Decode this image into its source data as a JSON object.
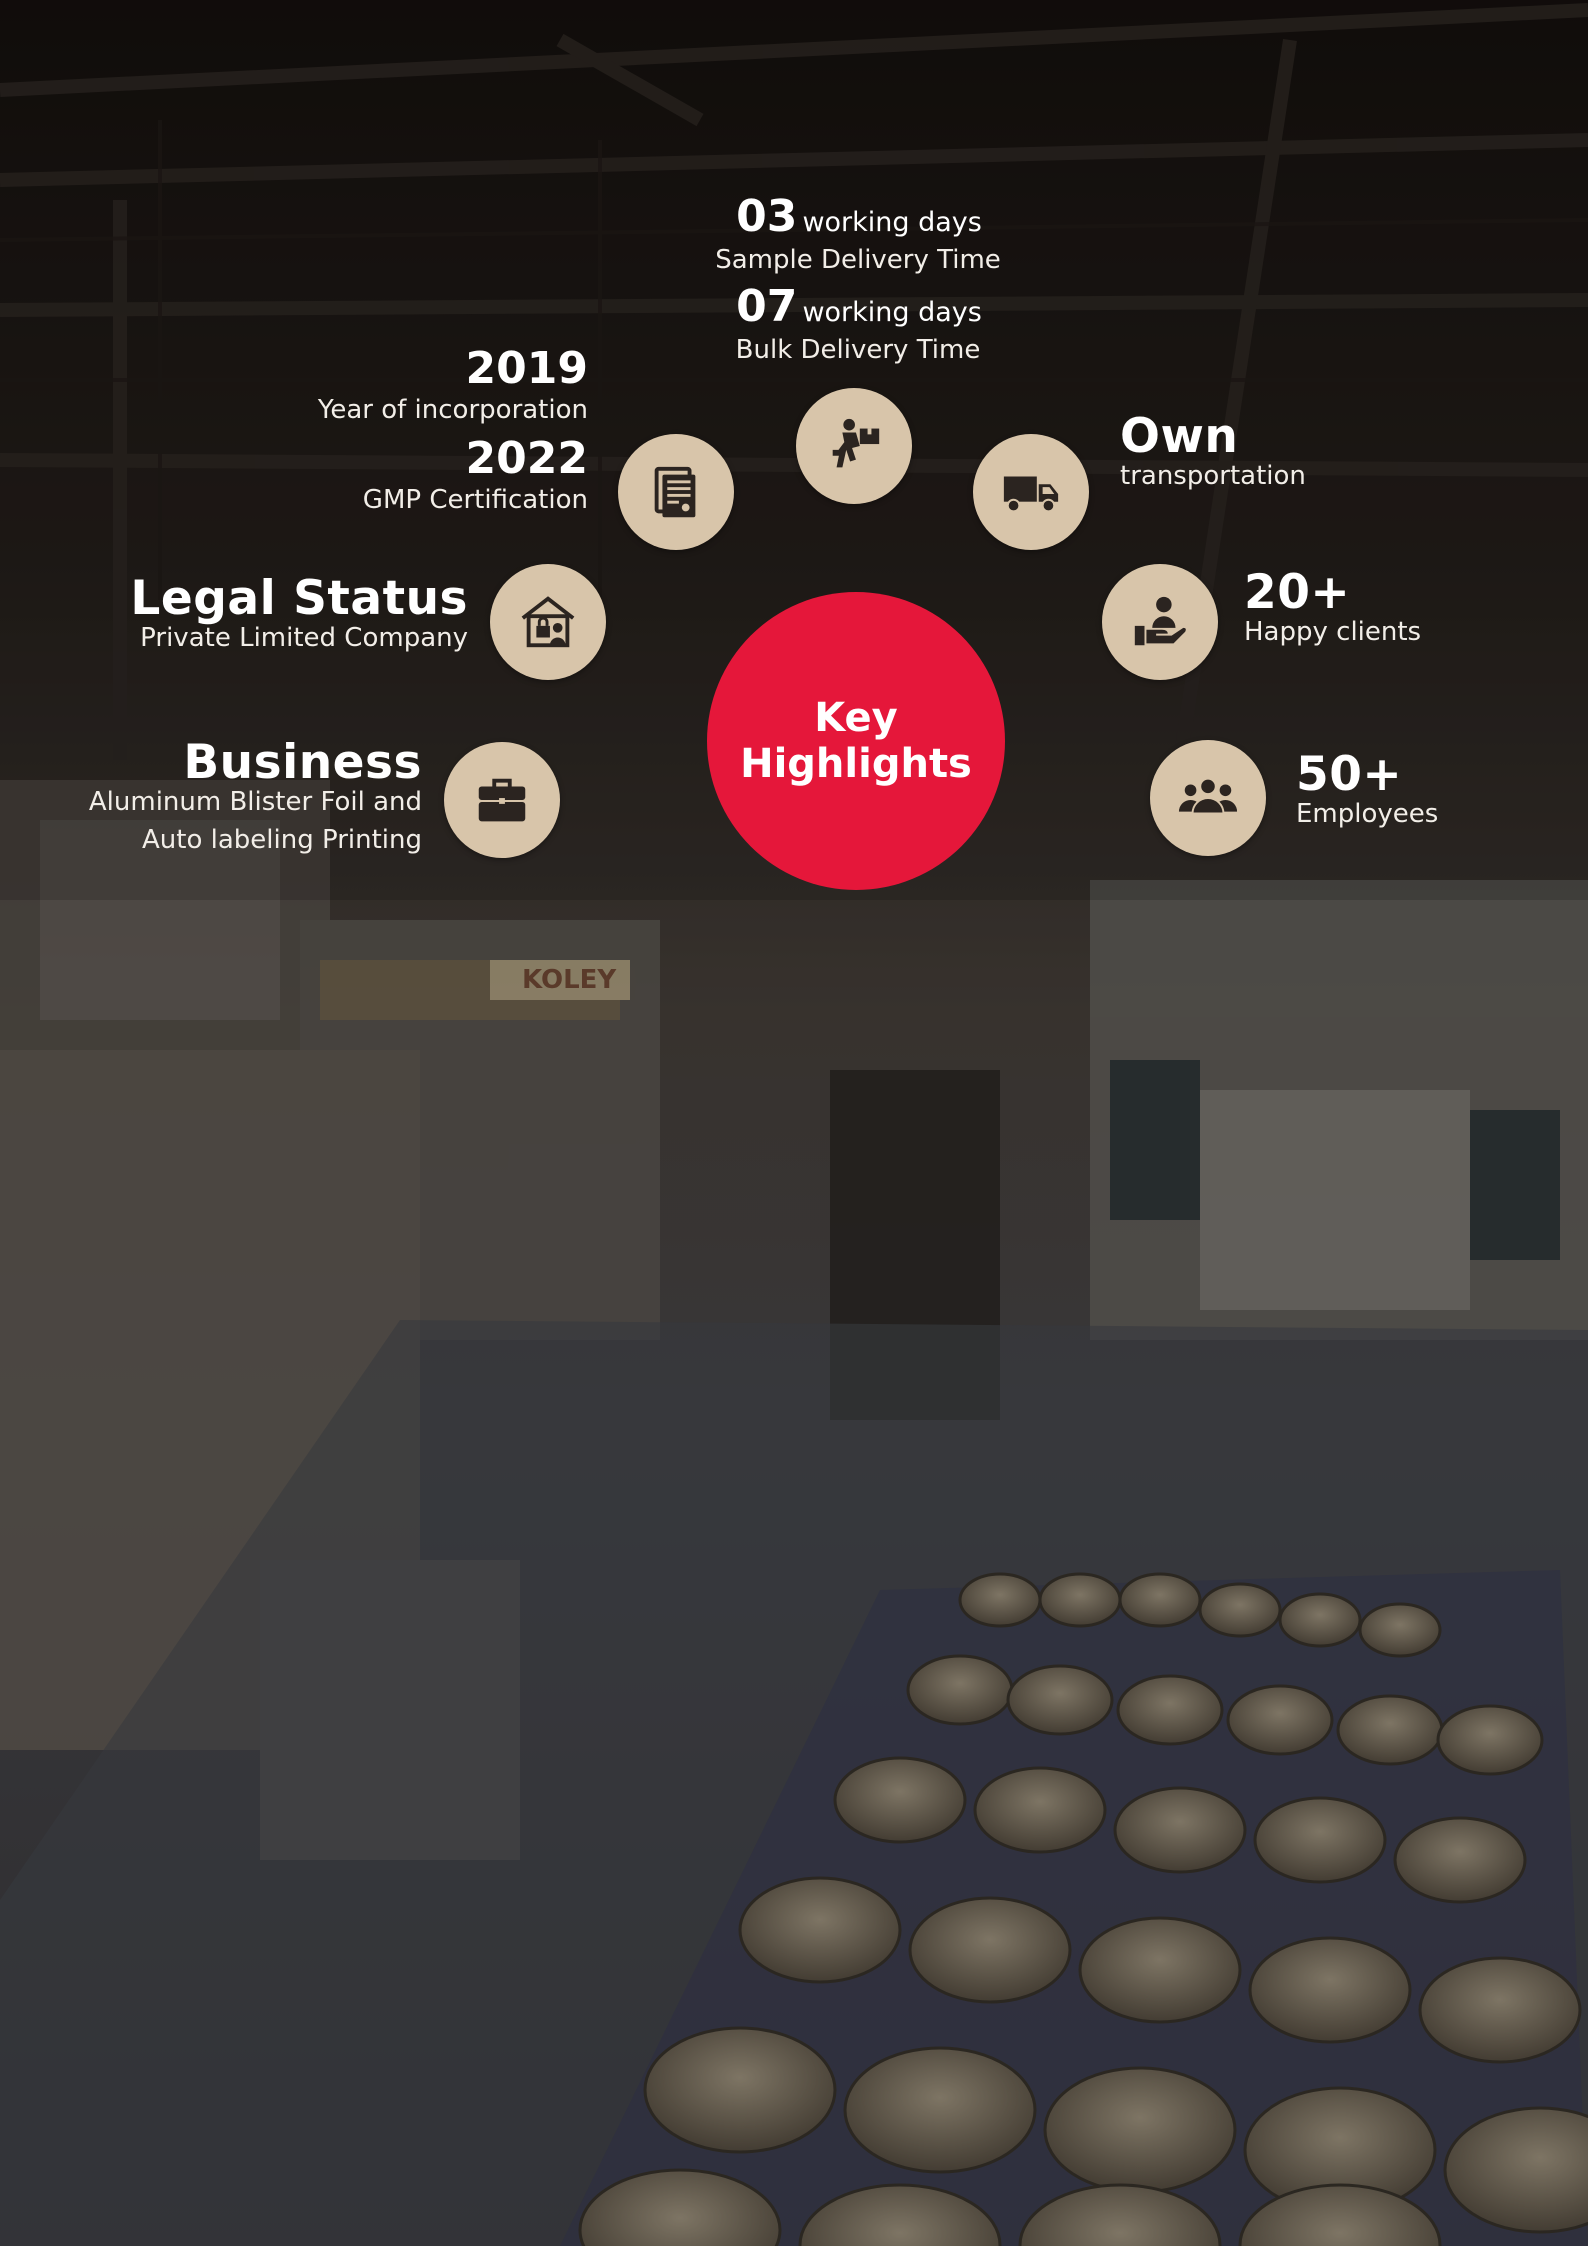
{
  "center": {
    "line1": "Key",
    "line2": "Highlights"
  },
  "delivery": {
    "sample": {
      "value": "03",
      "unit": "working days",
      "label": "Sample Delivery Time"
    },
    "bulk": {
      "value": "07",
      "unit": "working days",
      "label": "Bulk Delivery Time"
    }
  },
  "incorporation": {
    "value": "2019",
    "label": "Year of incorporation"
  },
  "gmp": {
    "value": "2022",
    "label": "GMP Certification"
  },
  "legal": {
    "value": "Legal Status",
    "label": "Private Limited Company"
  },
  "business": {
    "value": "Business",
    "label_line1": "Aluminum Blister Foil and",
    "label_line2": "Auto labeling Printing"
  },
  "transport": {
    "value": "Own",
    "label": "transportation"
  },
  "clients": {
    "value": "20+",
    "label": "Happy clients"
  },
  "employees": {
    "value": "50+",
    "label": "Employees"
  },
  "machine_brand": "KOLEY",
  "colors": {
    "accent": "#e5173a",
    "icon_bg": "#d8c5aa",
    "icon_fg": "#2b2420",
    "text": "#ffffff"
  },
  "icons": [
    "delivery-icon",
    "document-icon",
    "truck-icon",
    "legal-icon",
    "clients-icon",
    "briefcase-icon",
    "employees-icon"
  ]
}
